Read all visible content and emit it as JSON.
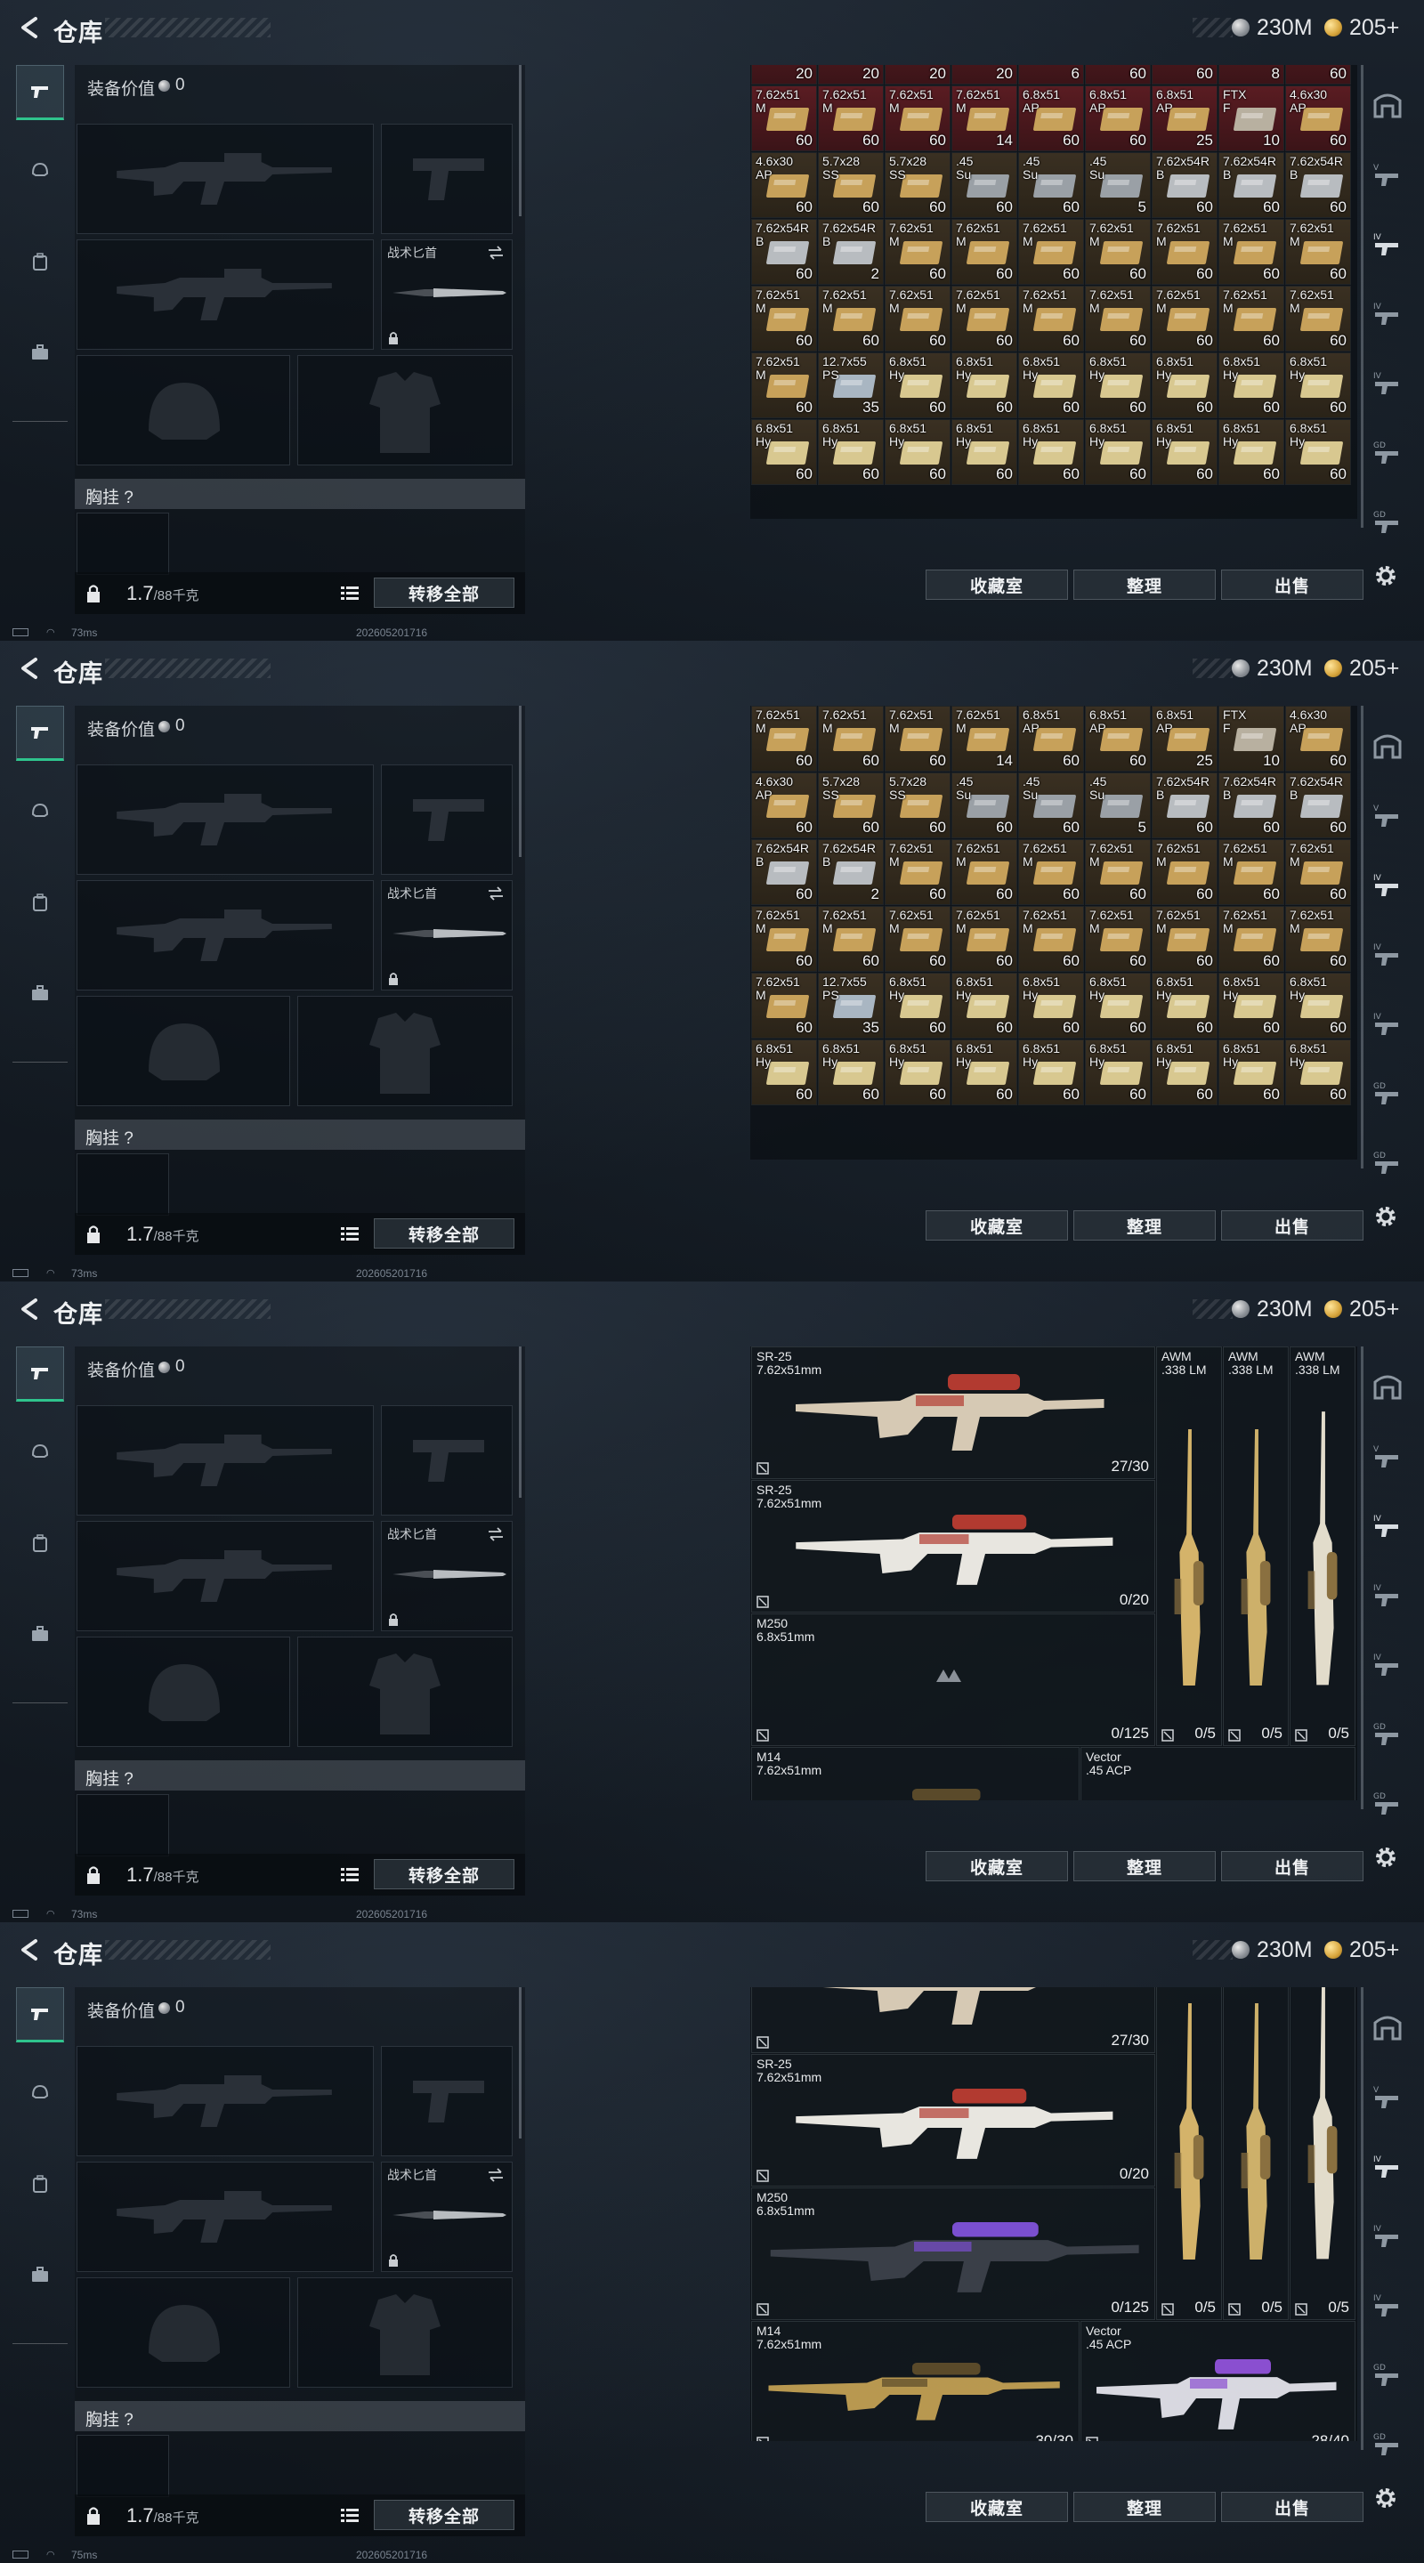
{
  "title": "仓库",
  "currency": {
    "silver": "230M",
    "gold": "205+"
  },
  "equipment": {
    "value_label": "装备价值",
    "value": "0",
    "knife_label": "战术匕首",
    "chest_rig_label": "胸挂 ?",
    "weight_value": "1.7",
    "weight_max": "/88千克",
    "transfer_all": "转移全部"
  },
  "actions": {
    "collection": "收藏室",
    "sort": "整理",
    "sell": "出售"
  },
  "status": {
    "ping1": "73ms",
    "ping2": "73ms",
    "ping3": "73ms",
    "ping4": "75ms",
    "timestamp": "202605201716"
  },
  "ammo_frame1": [
    [
      "",
      "20",
      "#3a3f35"
    ],
    [
      "",
      "20",
      "#3a3f35"
    ],
    [
      "",
      "20",
      "#3a3f35"
    ],
    [
      "",
      "20",
      "#3a3f35"
    ],
    [
      "",
      "6",
      "#3a3f35"
    ],
    [
      "",
      "60",
      "#9aa0a6"
    ],
    [
      "",
      "60",
      "#9aa0a6"
    ],
    [
      "",
      "8",
      "#9aa0a6"
    ],
    [
      "",
      "60",
      "#c7a15a"
    ],
    [
      "7.62x51\nM",
      "60",
      "#c7a15a"
    ],
    [
      "7.62x51\nM",
      "60",
      "#c7a15a"
    ],
    [
      "7.62x51\nM",
      "60",
      "#c7a15a"
    ],
    [
      "7.62x51\nM",
      "14",
      "#c7a15a"
    ],
    [
      "6.8x51\nAP",
      "60",
      "#c7a15a"
    ],
    [
      "6.8x51\nAP",
      "60",
      "#c7a15a"
    ],
    [
      "6.8x51\nAP",
      "25",
      "#c7a15a"
    ],
    [
      "FTX\nF",
      "10",
      "#b8b0a0"
    ],
    [
      "4.6x30\nAP",
      "60",
      "#c7a15a"
    ],
    [
      "4.6x30\nAP",
      "60",
      "#c7a15a"
    ],
    [
      "5.7x28\nSS",
      "60",
      "#c7a15a"
    ],
    [
      "5.7x28\nSS",
      "60",
      "#c7a15a"
    ],
    [
      ".45\nSu",
      "60",
      "#9aa0a6"
    ],
    [
      ".45\nSu",
      "60",
      "#9aa0a6"
    ],
    [
      ".45\nSu",
      "5",
      "#9aa0a6"
    ],
    [
      "7.62x54R\nB",
      "60",
      "#b8bcc0"
    ],
    [
      "7.62x54R\nB",
      "60",
      "#b8bcc0"
    ],
    [
      "7.62x54R\nB",
      "60",
      "#b8bcc0"
    ],
    [
      "7.62x54R\nB",
      "60",
      "#b8bcc0"
    ],
    [
      "7.62x54R\nB",
      "2",
      "#b8bcc0"
    ],
    [
      "7.62x51\nM",
      "60",
      "#c7a15a"
    ],
    [
      "7.62x51\nM",
      "60",
      "#c7a15a"
    ],
    [
      "7.62x51\nM",
      "60",
      "#c7a15a"
    ],
    [
      "7.62x51\nM",
      "60",
      "#c7a15a"
    ],
    [
      "7.62x51\nM",
      "60",
      "#c7a15a"
    ],
    [
      "7.62x51\nM",
      "60",
      "#c7a15a"
    ],
    [
      "7.62x51\nM",
      "60",
      "#c7a15a"
    ],
    [
      "7.62x51\nM",
      "60",
      "#c7a15a"
    ],
    [
      "7.62x51\nM",
      "60",
      "#c7a15a"
    ],
    [
      "7.62x51\nM",
      "60",
      "#c7a15a"
    ],
    [
      "7.62x51\nM",
      "60",
      "#c7a15a"
    ],
    [
      "7.62x51\nM",
      "60",
      "#c7a15a"
    ],
    [
      "7.62x51\nM",
      "60",
      "#c7a15a"
    ],
    [
      "7.62x51\nM",
      "60",
      "#c7a15a"
    ],
    [
      "7.62x51\nM",
      "60",
      "#c7a15a"
    ],
    [
      "7.62x51\nM",
      "60",
      "#c7a15a"
    ],
    [
      "7.62x51\nM",
      "60",
      "#c7a15a"
    ],
    [
      "12.7x55\nPS",
      "35",
      "#a9b6c2"
    ],
    [
      "6.8x51\nHy",
      "60",
      "#d8c890"
    ],
    [
      "6.8x51\nHy",
      "60",
      "#d8c890"
    ],
    [
      "6.8x51\nHy",
      "60",
      "#d8c890"
    ],
    [
      "6.8x51\nHy",
      "60",
      "#d8c890"
    ],
    [
      "6.8x51\nHy",
      "60",
      "#d8c890"
    ],
    [
      "6.8x51\nHy",
      "60",
      "#d8c890"
    ],
    [
      "6.8x51\nHy",
      "60",
      "#d8c890"
    ],
    [
      "6.8x51\nHy",
      "60",
      "#d8c890"
    ],
    [
      "6.8x51\nHy",
      "60",
      "#d8c890"
    ],
    [
      "6.8x51\nHy",
      "60",
      "#d8c890"
    ],
    [
      "6.8x51\nHy",
      "60",
      "#d8c890"
    ],
    [
      "6.8x51\nHy",
      "60",
      "#d8c890"
    ],
    [
      "6.8x51\nHy",
      "60",
      "#d8c890"
    ],
    [
      "6.8x51\nHy",
      "60",
      "#d8c890"
    ],
    [
      "6.8x51\nHy",
      "60",
      "#d8c890"
    ],
    [
      "6.8x51\nHy",
      "60",
      "#d8c890"
    ]
  ],
  "weapons_frame3": {
    "sr25a": {
      "name": "SR-25\n7.62x51mm",
      "count": "27/30"
    },
    "sr25b": {
      "name": "SR-25\n7.62x51mm",
      "count": "0/20"
    },
    "m250": {
      "name": "M250\n6.8x51mm",
      "count": "0/125"
    },
    "awm1": {
      "name": "AWM\n.338 LM",
      "count": "0/5"
    },
    "awm2": {
      "name": "AWM\n.338 LM",
      "count": "0/5"
    },
    "awm3": {
      "name": "AWM\n.338 LM",
      "count": "0/5"
    },
    "m14": {
      "name": "M14\n7.62x51mm",
      "count": ""
    },
    "vector": {
      "name": "Vector\n.45 ACP",
      "count": ""
    }
  },
  "weapons_frame4": {
    "sr25a": {
      "name": "",
      "count": "27/30"
    },
    "sr25b": {
      "name": "SR-25\n7.62x51mm",
      "count": "0/20"
    },
    "m250": {
      "name": "M250\n6.8x51mm",
      "count": "0/125"
    },
    "awm1": {
      "name": "",
      "count": "0/5"
    },
    "awm2": {
      "name": "",
      "count": "0/5"
    },
    "awm3": {
      "name": "",
      "count": "0/5"
    },
    "m14": {
      "name": "M14\n7.62x51mm",
      "count": "30/30"
    },
    "vector": {
      "name": "Vector\n.45 ACP",
      "count": "28/40"
    }
  }
}
